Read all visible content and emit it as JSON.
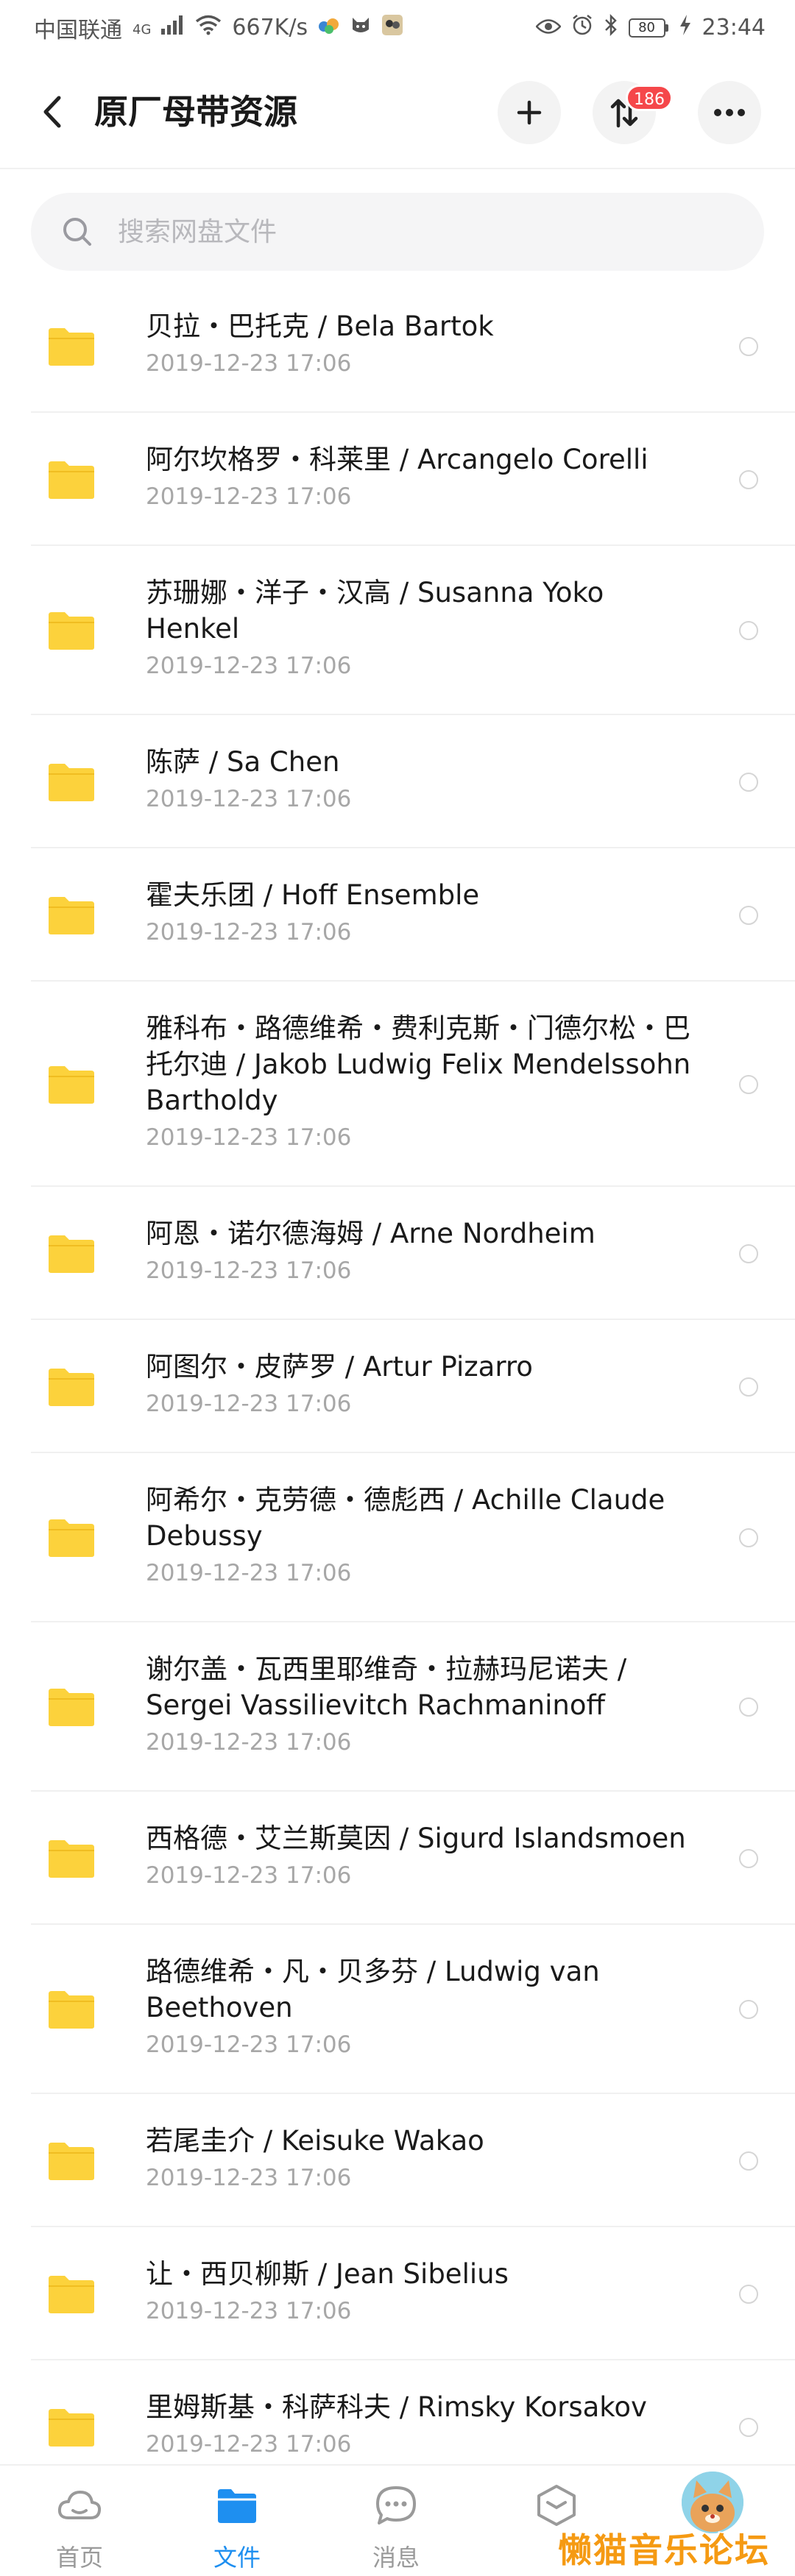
{
  "status_bar": {
    "carrier": "中国联通",
    "network": "4G",
    "speed": "667K/s",
    "battery": "80",
    "time": "23:44"
  },
  "header": {
    "title": "原厂母带资源",
    "transfer_badge": "186"
  },
  "search": {
    "placeholder": "搜索网盘文件"
  },
  "files": [
    {
      "name": "贝拉・巴托克 / Bela Bartok",
      "date": "2019-12-23  17:06"
    },
    {
      "name": "阿尔坎格罗・科莱里 / Arcangelo Corelli",
      "date": "2019-12-23  17:06"
    },
    {
      "name": "苏珊娜・洋子・汉高 / Susanna Yoko Henkel",
      "date": "2019-12-23  17:06"
    },
    {
      "name": "陈萨 / Sa Chen",
      "date": "2019-12-23  17:06"
    },
    {
      "name": "霍夫乐团 / Hoff Ensemble",
      "date": "2019-12-23  17:06"
    },
    {
      "name": "雅科布・路德维希・费利克斯・门德尔松・巴托尔迪 / Jakob Ludwig Felix Mendelssohn Bartholdy",
      "date": "2019-12-23  17:06"
    },
    {
      "name": "阿恩・诺尔德海姆 / Arne Nordheim",
      "date": "2019-12-23  17:06"
    },
    {
      "name": "阿图尔・皮萨罗 / Artur Pizarro",
      "date": "2019-12-23  17:06"
    },
    {
      "name": "阿希尔・克劳德・德彪西 / Achille Claude Debussy",
      "date": "2019-12-23  17:06"
    },
    {
      "name": "谢尔盖・瓦西里耶维奇・拉赫玛尼诺夫 / Sergei Vassilievitch Rachmaninoff",
      "date": "2019-12-23  17:06"
    },
    {
      "name": "西格德・艾兰斯莫因 / Sigurd Islandsmoen",
      "date": "2019-12-23  17:06"
    },
    {
      "name": "路德维希・凡・贝多芬 / Ludwig van Beethoven",
      "date": "2019-12-23  17:06"
    },
    {
      "name": "若尾圭介 / Keisuke Wakao",
      "date": "2019-12-23  17:06"
    },
    {
      "name": "让・西贝柳斯 / Jean Sibelius",
      "date": "2019-12-23  17:06"
    },
    {
      "name": "里姆斯基・科萨科夫 / Rimsky Korsakov",
      "date": "2019-12-23  17:06"
    }
  ],
  "bottom_nav": {
    "home": "首页",
    "files": "文件",
    "messages": "消息"
  },
  "watermark": "懒猫音乐论坛",
  "colors": {
    "accent": "#1e8ff0",
    "folder": "#fcd23c",
    "badge": "#f5474a",
    "watermark": "#f59a13"
  }
}
